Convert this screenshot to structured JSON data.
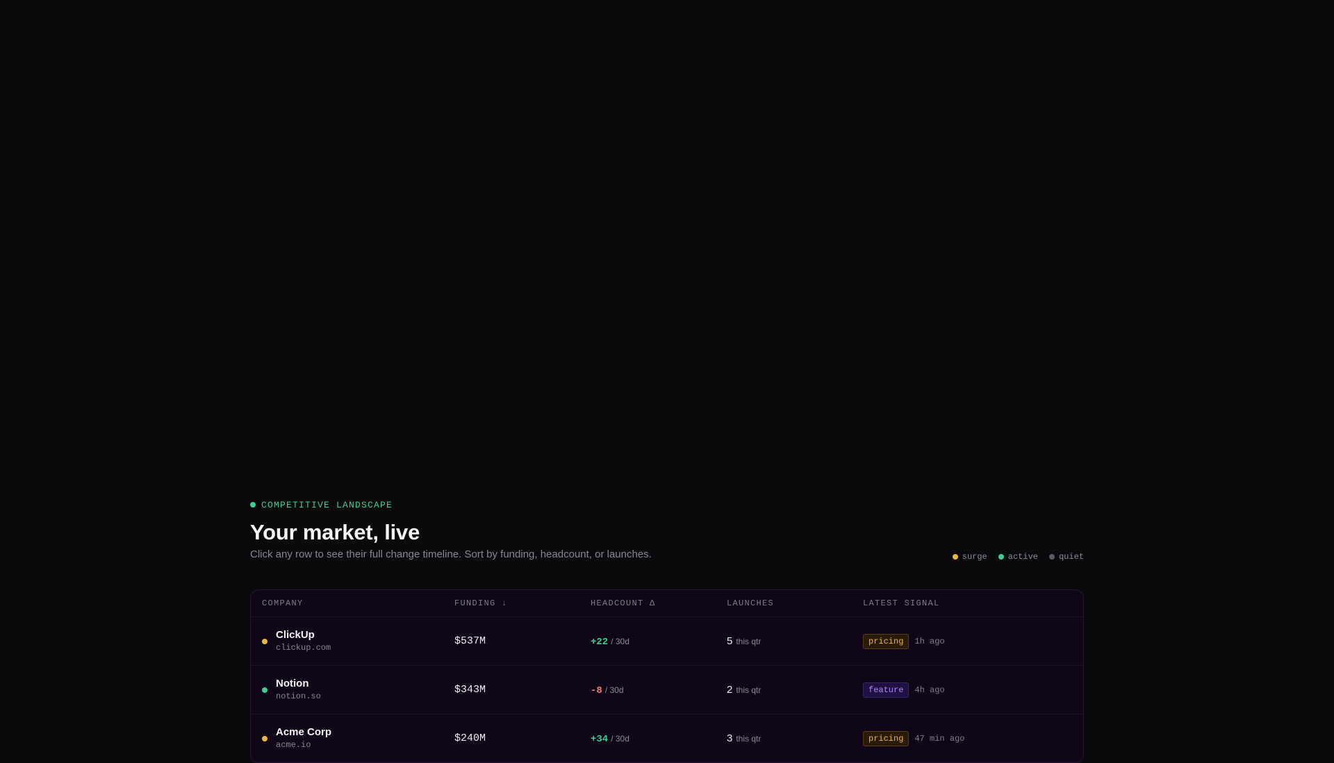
{
  "header": {
    "eyebrow": "COMPETITIVE LANDSCAPE",
    "title": "Your market, live",
    "subtitle": "Click any row to see their full change timeline. Sort by funding, headcount, or launches."
  },
  "legend": [
    {
      "label": "surge",
      "color": "#e9b73a"
    },
    {
      "label": "active",
      "color": "#3ccf91"
    },
    {
      "label": "quiet",
      "color": "#5a5a62"
    }
  ],
  "table": {
    "columns": {
      "company": "COMPANY",
      "funding": "FUNDING ↓",
      "headcount": "HEADCOUNT Δ",
      "launches": "LAUNCHES",
      "signal": "LATEST SIGNAL"
    },
    "rows": [
      {
        "status": "surge",
        "status_color": "#e9b73a",
        "name": "ClickUp",
        "domain": "clickup.com",
        "funding": "$537M",
        "headcount_delta": "+22",
        "headcount_period": "/ 30d",
        "headcount_trend": "up",
        "launches": "5",
        "launches_unit": "this qtr",
        "signal_tag": "pricing",
        "signal_time": "1h ago"
      },
      {
        "status": "active",
        "status_color": "#3ccf91",
        "name": "Notion",
        "domain": "notion.so",
        "funding": "$343M",
        "headcount_delta": "-8",
        "headcount_period": "/ 30d",
        "headcount_trend": "down",
        "launches": "2",
        "launches_unit": "this qtr",
        "signal_tag": "feature",
        "signal_time": "4h ago"
      },
      {
        "status": "surge",
        "status_color": "#e9b73a",
        "name": "Acme Corp",
        "domain": "acme.io",
        "funding": "$240M",
        "headcount_delta": "+34",
        "headcount_period": "/ 30d",
        "headcount_trend": "up",
        "launches": "3",
        "launches_unit": "this qtr",
        "signal_tag": "pricing",
        "signal_time": "47 min ago"
      }
    ]
  }
}
